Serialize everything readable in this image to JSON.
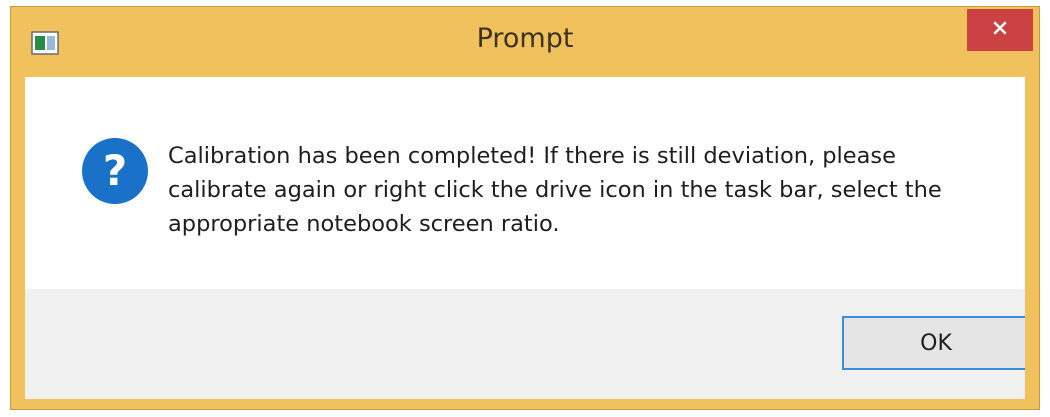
{
  "window": {
    "title": "Prompt",
    "frame_color": "#f1c15d",
    "close_button_color": "#cc4242",
    "app_icon": "window-app-icon",
    "close_icon": "close-icon"
  },
  "dialog": {
    "icon": "question-icon",
    "icon_color": "#1a72c8",
    "message": "Calibration has been completed! If there is still deviation, please\ncalibrate again or right click the drive icon in the task bar, select the\nappropriate notebook screen ratio."
  },
  "buttons": {
    "ok_label": "OK",
    "ok_focus_color": "#3c8cdc"
  }
}
